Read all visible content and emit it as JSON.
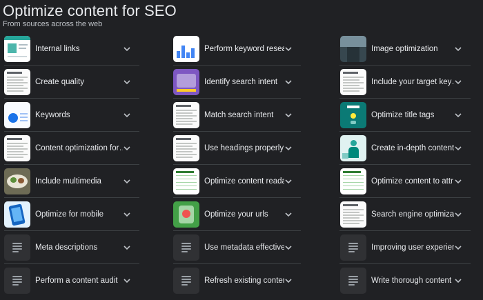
{
  "header": {
    "title": "Optimize content for SEO",
    "subtitle": "From sources across the web"
  },
  "columns": [
    {
      "items": [
        {
          "label": "Internal links",
          "thumb": "webpage"
        },
        {
          "label": "Create quality",
          "thumb": "textdoc"
        },
        {
          "label": "Keywords",
          "thumb": "bluechart"
        },
        {
          "label": "Content optimization for…",
          "thumb": "textdoc"
        },
        {
          "label": "Include multimedia",
          "thumb": "food"
        },
        {
          "label": "Optimize for mobile",
          "thumb": "mobile"
        },
        {
          "label": "Meta descriptions",
          "thumb": "doc-icon"
        },
        {
          "label": "Perform a content audit",
          "thumb": "doc-icon"
        }
      ]
    },
    {
      "items": [
        {
          "label": "Perform keyword resear…",
          "thumb": "analytics"
        },
        {
          "label": "Identify search intent",
          "thumb": "purple"
        },
        {
          "label": "Match search intent",
          "thumb": "textdoc"
        },
        {
          "label": "Use headings properly",
          "thumb": "textdoc"
        },
        {
          "label": "Optimize content reada…",
          "thumb": "table"
        },
        {
          "label": "Optimize your urls",
          "thumb": "green"
        },
        {
          "label": "Use metadata effectively",
          "thumb": "doc-icon"
        },
        {
          "label": "Refresh existing content",
          "thumb": "doc-icon"
        }
      ]
    },
    {
      "items": [
        {
          "label": "Image optimization",
          "thumb": "road"
        },
        {
          "label": "Include your target key…",
          "thumb": "textdoc"
        },
        {
          "label": "Optimize title tags",
          "thumb": "teal"
        },
        {
          "label": "Create in-depth content",
          "thumb": "person"
        },
        {
          "label": "Optimize content to attr…",
          "thumb": "table"
        },
        {
          "label": "Search engine optimizat…",
          "thumb": "textdoc"
        },
        {
          "label": "Improving user experien…",
          "thumb": "doc-icon"
        },
        {
          "label": "Write thorough content",
          "thumb": "doc-icon"
        }
      ]
    }
  ],
  "icons": {
    "expand": "chevron-down-icon",
    "document": "document-icon"
  },
  "colors": {
    "background": "#202124",
    "text": "#e8eaed",
    "divider": "#3c4043"
  }
}
